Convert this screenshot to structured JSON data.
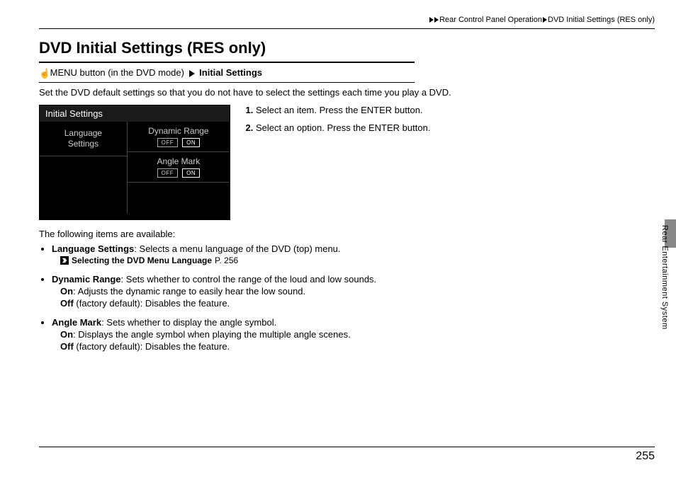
{
  "breadcrumb": {
    "section": "Rear Control Panel Operation",
    "page": "DVD Initial Settings (RES only)"
  },
  "title": "DVD Initial Settings (RES only)",
  "menu_path": {
    "button_text": "MENU button (in the DVD mode)",
    "target": "Initial Settings"
  },
  "intro": "Set the DVD default settings so that you do not have to select the settings each time you play a DVD.",
  "screen": {
    "header": "Initial Settings",
    "left": {
      "line1": "Language",
      "line2": "Settings"
    },
    "right": [
      {
        "label": "Dynamic Range",
        "off": "OFF",
        "on": "ON"
      },
      {
        "label": "Angle Mark",
        "off": "OFF",
        "on": "ON"
      }
    ]
  },
  "steps": [
    "Select an item. Press the ENTER button.",
    "Select an option. Press the ENTER button."
  ],
  "following_heading": "The following items are available:",
  "items": {
    "lang": {
      "name": "Language Settings",
      "desc": ": Selects a menu language of the DVD (top) menu.",
      "ref_text": "Selecting the DVD Menu Language",
      "ref_page": "P. 256"
    },
    "range": {
      "name": "Dynamic Range",
      "desc": ": Sets whether to control the range of the loud and low sounds.",
      "on_label": "On",
      "on_desc": ": Adjusts the dynamic range to easily hear the low sound.",
      "off_label": "Off",
      "off_desc": " (factory default): Disables the feature."
    },
    "angle": {
      "name": "Angle Mark",
      "desc": ": Sets whether to display the angle symbol.",
      "on_label": "On",
      "on_desc": ": Displays the angle symbol when playing the multiple angle scenes.",
      "off_label": "Off",
      "off_desc": " (factory default): Disables the feature."
    }
  },
  "side_tab": "Rear Entertainment System",
  "page_number": "255"
}
